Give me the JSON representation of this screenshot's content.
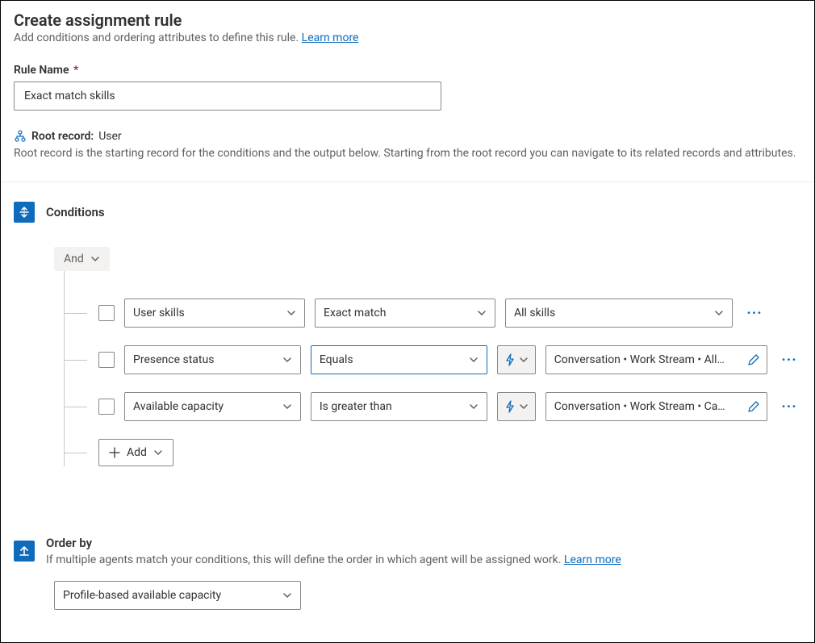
{
  "header": {
    "title": "Create assignment rule",
    "subtitle_prefix": "Add conditions and ordering attributes to define this rule. ",
    "learn_more": "Learn more"
  },
  "rule_name": {
    "label": "Rule Name",
    "required_marker": "*",
    "value": "Exact match skills"
  },
  "root_record": {
    "label": "Root record:",
    "value": "User",
    "description": "Root record is the starting record for the conditions and the output below. Starting from the root record you can navigate to its related records and attributes."
  },
  "conditions": {
    "section_title": "Conditions",
    "group_operator": "And",
    "add_label": "Add",
    "rows": [
      {
        "attribute": "User skills",
        "operator": "Exact match",
        "value_mode": "dropdown",
        "value": "All skills"
      },
      {
        "attribute": "Presence status",
        "operator": "Equals",
        "operator_selected": true,
        "value_mode": "lookup",
        "value": "Conversation • Work Stream • All…"
      },
      {
        "attribute": "Available capacity",
        "operator": "Is greater than",
        "value_mode": "lookup",
        "value": "Conversation • Work Stream • Ca…"
      }
    ]
  },
  "order_by": {
    "section_title": "Order by",
    "description_prefix": "If multiple agents match your conditions, this will define the order in which agent will be assigned work. ",
    "learn_more": "Learn more",
    "value": "Profile-based available capacity"
  },
  "colors": {
    "accent": "#0f6cbd"
  }
}
